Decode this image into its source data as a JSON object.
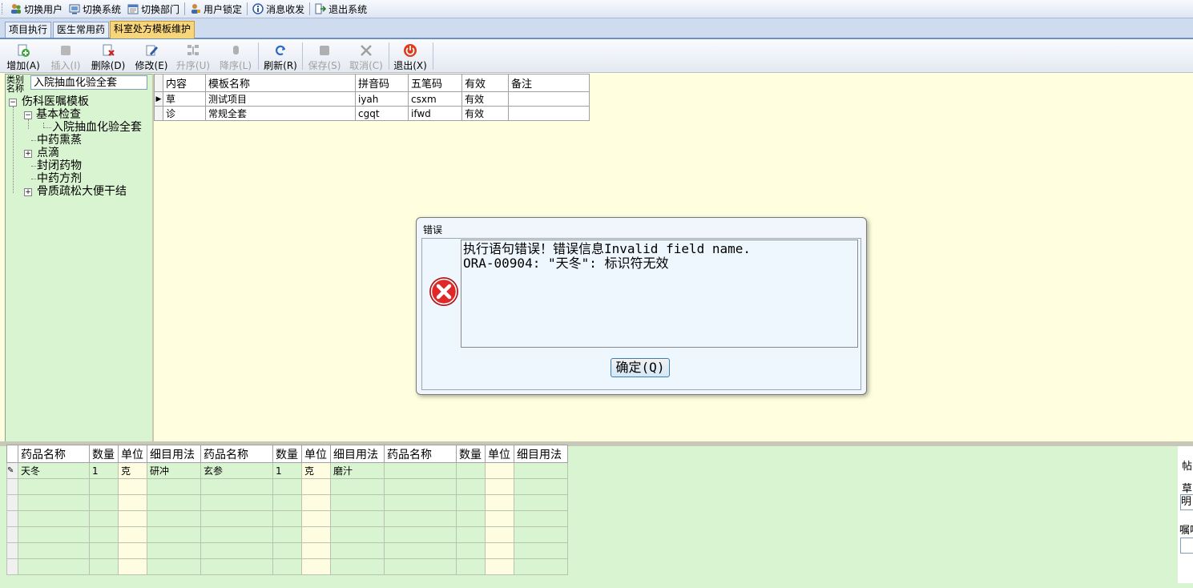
{
  "menubar": {
    "items": [
      {
        "label": "切换用户",
        "icon": "users-icon"
      },
      {
        "label": "切换系统",
        "icon": "system-icon"
      },
      {
        "label": "切换部门",
        "icon": "department-icon"
      },
      {
        "label": "用户锁定",
        "icon": "user-lock-icon"
      },
      {
        "label": "消息收发",
        "icon": "info-icon"
      },
      {
        "label": "退出系统",
        "icon": "logout-icon"
      }
    ]
  },
  "tabs": [
    {
      "label": "项目执行",
      "active": false
    },
    {
      "label": "医生常用药",
      "active": false
    },
    {
      "label": "科室处方模板维护",
      "active": true
    }
  ],
  "toolbar": {
    "add": "增加(A)",
    "insert": "插入(I)",
    "delete": "删除(D)",
    "edit": "修改(E)",
    "sort_up": "升序(U)",
    "sort_down": "降序(L)",
    "refresh": "刷新(R)",
    "save": "保存(S)",
    "cancel": "取消(C)",
    "exit": "退出(X)"
  },
  "category": {
    "label": "类别名称",
    "value": "入院抽血化验全套"
  },
  "tree": {
    "root": "伤科医嘱模板",
    "nodes": {
      "basic_exam": "基本检查",
      "blood_test": "入院抽血化验全套",
      "herbal_steam": "中药熏蒸",
      "drip": "点滴",
      "block_drug": "封闭药物",
      "herbal_formula": "中药方剂",
      "osteoporosis": "骨质疏松大便干结"
    }
  },
  "template_grid": {
    "columns": [
      "内容",
      "模板名称",
      "拼音码",
      "五笔码",
      "有效",
      "备注"
    ],
    "rows": [
      {
        "content": "草",
        "name": "测试项目",
        "pinyin": "iyah",
        "wubi": "csxm",
        "valid": "有效",
        "note": ""
      },
      {
        "content": "诊",
        "name": "常规全套",
        "pinyin": "cgqt",
        "wubi": "ifwd",
        "valid": "有效",
        "note": ""
      }
    ]
  },
  "drug_grid": {
    "columns": [
      "药品名称",
      "数量",
      "单位",
      "细目用法",
      "药品名称",
      "数量",
      "单位",
      "细目用法",
      "药品名称",
      "数量",
      "单位",
      "细目用法"
    ],
    "row1": [
      "天冬",
      "1",
      "克",
      "研冲",
      "玄参",
      "1",
      "克",
      "磨汁",
      "",
      "",
      "",
      ""
    ]
  },
  "right_panel": {
    "label1": "帖",
    "label2": "草",
    "value2": "明",
    "label3": "嘱咐"
  },
  "dialog": {
    "title": "错误",
    "message": "执行语句错误！错误信息Invalid field name.\nORA-00904: \"天冬\": 标识符无效",
    "ok": "确定(Q)"
  }
}
